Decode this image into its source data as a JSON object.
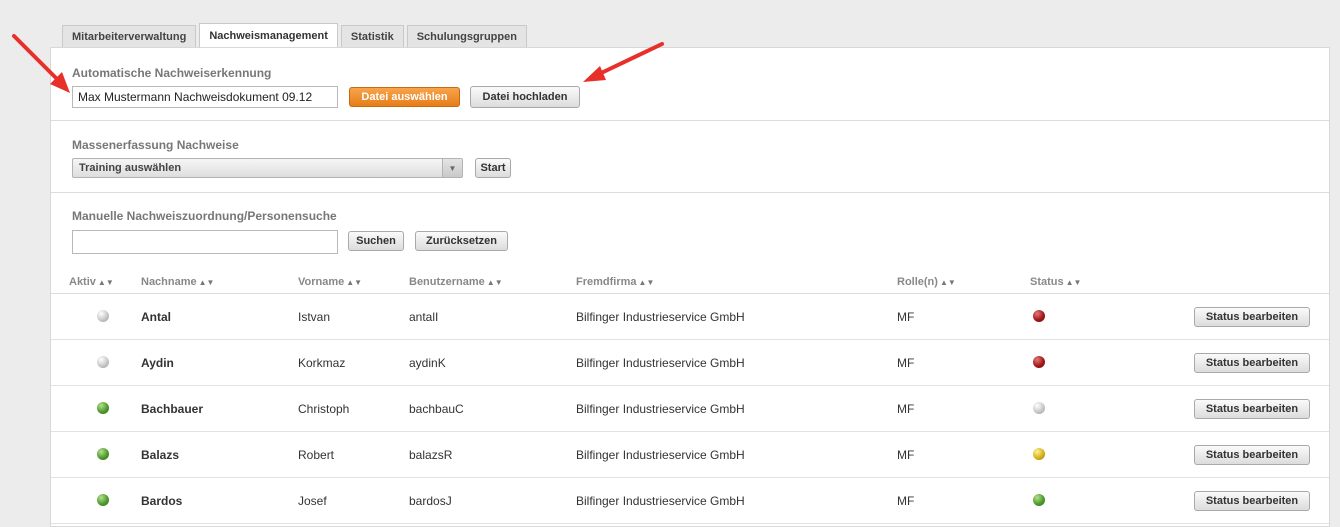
{
  "tabs": [
    {
      "label": "Mitarbeiterverwaltung",
      "active": false
    },
    {
      "label": "Nachweismanagement",
      "active": true
    },
    {
      "label": "Statistik",
      "active": false
    },
    {
      "label": "Schulungsgruppen",
      "active": false
    }
  ],
  "auto": {
    "title": "Automatische Nachweiserkennung",
    "file_value": "Max Mustermann Nachweisdokument 09.12",
    "choose_label": "Datei auswählen",
    "upload_label": "Datei hochladen"
  },
  "mass": {
    "title": "Massenerfassung Nachweise",
    "select_value": "Training auswählen",
    "start_label": "Start"
  },
  "manual": {
    "title": "Manuelle Nachweiszuordnung/Personensuche",
    "search_value": "",
    "search_label": "Suchen",
    "reset_label": "Zurücksetzen"
  },
  "table": {
    "headers": {
      "aktiv": "Aktiv",
      "nachname": "Nachname",
      "vorname": "Vorname",
      "benutzername": "Benutzername",
      "fremdfirma": "Fremdfirma",
      "rollen": "Rolle(n)",
      "status": "Status"
    },
    "sort_icon": "sort-arrows-icon",
    "action_label": "Status bearbeiten",
    "rows": [
      {
        "aktiv": "grey",
        "nachname": "Antal",
        "vorname": "Istvan",
        "benutzername": "antalI",
        "fremdfirma": "Bilfinger Industrieservice GmbH",
        "rolle": "MF",
        "status": "red"
      },
      {
        "aktiv": "grey",
        "nachname": "Aydin",
        "vorname": "Korkmaz",
        "benutzername": "aydinK",
        "fremdfirma": "Bilfinger Industrieservice GmbH",
        "rolle": "MF",
        "status": "red"
      },
      {
        "aktiv": "green",
        "nachname": "Bachbauer",
        "vorname": "Christoph",
        "benutzername": "bachbauC",
        "fremdfirma": "Bilfinger Industrieservice GmbH",
        "rolle": "MF",
        "status": "grey"
      },
      {
        "aktiv": "green",
        "nachname": "Balazs",
        "vorname": "Robert",
        "benutzername": "balazsR",
        "fremdfirma": "Bilfinger Industrieservice GmbH",
        "rolle": "MF",
        "status": "yellow"
      },
      {
        "aktiv": "green",
        "nachname": "Bardos",
        "vorname": "Josef",
        "benutzername": "bardosJ",
        "fremdfirma": "Bilfinger Industrieservice GmbH",
        "rolle": "MF",
        "status": "green"
      }
    ]
  },
  "colors": {
    "accent_orange": "#f08a24",
    "annotation_arrow": "#e8302a",
    "status_red": "#a3171a",
    "status_green": "#4f9a2f",
    "status_yellow": "#d6b21a",
    "status_grey": "#c8c8c8"
  }
}
